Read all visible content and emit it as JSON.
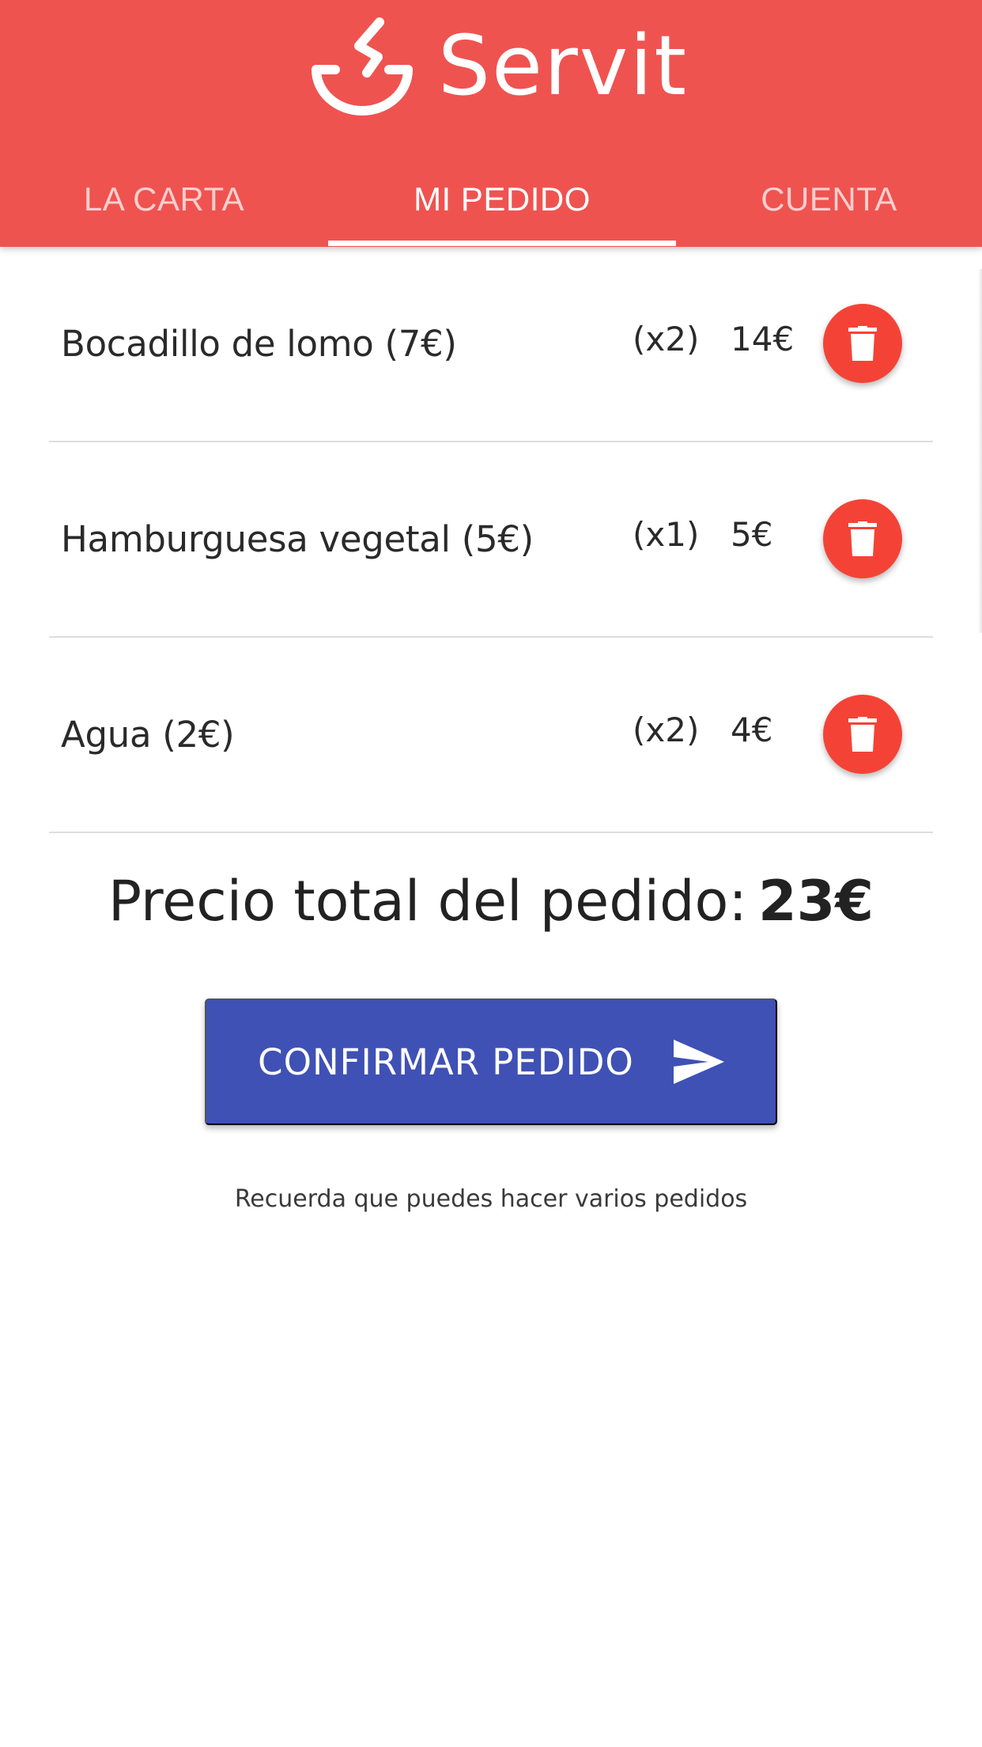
{
  "app": {
    "name": "Servit",
    "logo_icon": "servit-logo-icon",
    "colors": {
      "header": "#ef5350",
      "delete_button": "#f44336",
      "confirm_button": "#3f51b5"
    }
  },
  "tabs": [
    {
      "label": "LA CARTA",
      "active": false
    },
    {
      "label": "MI PEDIDO",
      "active": true
    },
    {
      "label": "CUENTA",
      "active": false
    }
  ],
  "order": {
    "items": [
      {
        "name": "Bocadillo de lomo (7€)",
        "qty": "(x2)",
        "subtotal": "14€",
        "delete_icon": "trash-icon"
      },
      {
        "name": "Hamburguesa vegetal (5€)",
        "qty": "(x1)",
        "subtotal": "5€",
        "delete_icon": "trash-icon"
      },
      {
        "name": "Agua (2€)",
        "qty": "(x2)",
        "subtotal": "4€",
        "delete_icon": "trash-icon"
      }
    ],
    "total_label": "Precio total del pedido:",
    "total_value": "23€"
  },
  "confirm": {
    "label": "CONFIRMAR PEDIDO",
    "icon": "send-icon"
  },
  "hint": "Recuerda que puedes hacer varios pedidos"
}
